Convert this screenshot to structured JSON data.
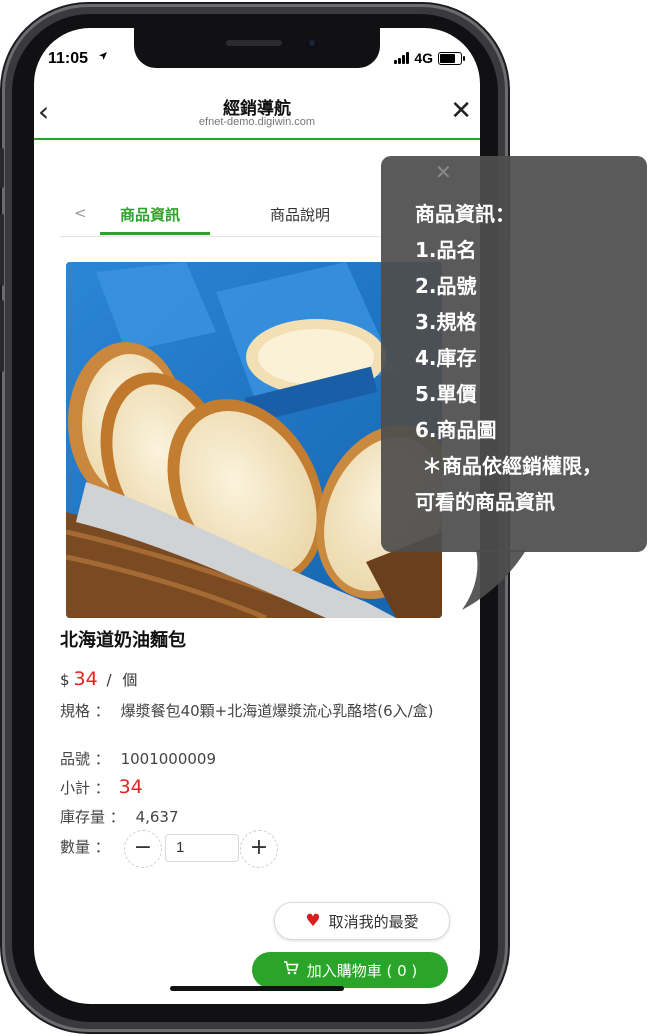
{
  "status_bar": {
    "time": "11:05",
    "network": "4G"
  },
  "nav": {
    "back_icon": "‹",
    "title": "經銷導航",
    "url": "efnet-demo.digiwin.com",
    "close_icon": "✕"
  },
  "tabs": {
    "prev_arrow": "<",
    "items": [
      {
        "label": "商品資訊",
        "active": true
      },
      {
        "label": "商品說明",
        "active": false
      }
    ]
  },
  "product": {
    "name": "北海道奶油麵包",
    "currency": "$",
    "price": "34",
    "unit_sep": "/",
    "unit": "個",
    "spec_label": "規格 ：",
    "spec": "爆漿餐包40顆+北海道爆漿流心乳酪塔(6入/盒)",
    "code_label": "品號 ：",
    "code": "1001000009",
    "subtotal_label": "小計 ：",
    "subtotal": "34",
    "stock_label": "庫存量 ：",
    "stock": "4,637",
    "qty_label": "數量 ：",
    "quantity": "1",
    "minus": "−",
    "plus": "+"
  },
  "actions": {
    "favorite": "取消我的最愛",
    "cart": "加入購物車 ( 0 )"
  },
  "callout": {
    "close_icon": "✕",
    "lines": [
      "商品資訊：",
      "1.品名",
      "2.品號",
      "3.規格",
      "4.庫存",
      "5.單價",
      "6.商品圖",
      " ＊商品依經銷權限，",
      "可看的商品資訊"
    ]
  },
  "colors": {
    "accent": "#2aa52a",
    "price": "#e3231d",
    "callout_bg": "#4e4e4e"
  }
}
